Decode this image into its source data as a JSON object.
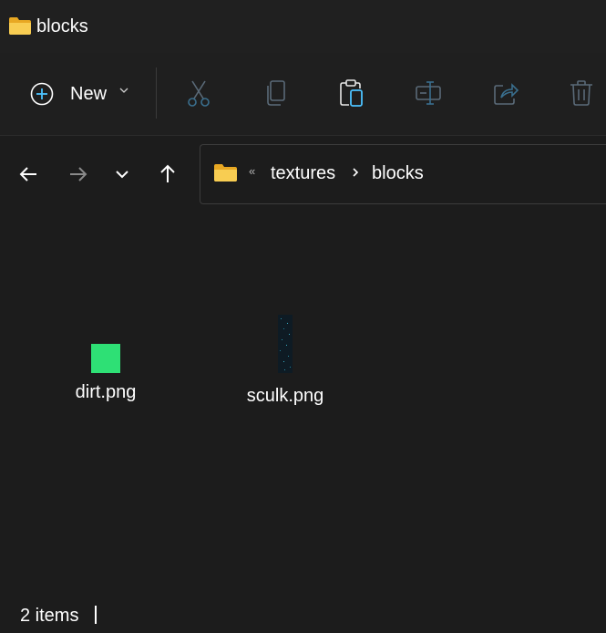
{
  "window": {
    "title": "blocks",
    "icon": "folder-icon"
  },
  "command_bar": {
    "new_label": "New",
    "buttons": [
      {
        "name": "cut",
        "icon": "scissors-icon",
        "enabled": false
      },
      {
        "name": "copy",
        "icon": "copy-icon",
        "enabled": false
      },
      {
        "name": "paste",
        "icon": "clipboard-paste-icon",
        "enabled": true
      },
      {
        "name": "rename",
        "icon": "rename-icon",
        "enabled": false
      },
      {
        "name": "share",
        "icon": "share-icon",
        "enabled": false
      },
      {
        "name": "delete",
        "icon": "trash-icon",
        "enabled": false
      }
    ]
  },
  "navigation": {
    "back_icon": "arrow-left-icon",
    "forward_icon": "arrow-right-icon",
    "recent_icon": "chevron-down-icon",
    "up_icon": "arrow-up-icon"
  },
  "address_bar": {
    "overflow": "«",
    "crumbs": [
      "textures",
      "blocks"
    ]
  },
  "files": [
    {
      "name": "dirt.png",
      "thumb_color": "#2ee075"
    },
    {
      "name": "sculk.png",
      "thumb_color": "#0d1a22"
    }
  ],
  "status": {
    "item_count": "2 items"
  },
  "colors": {
    "background": "#1c1c1c",
    "folder_yellow": "#f4c34a",
    "accent": "#4cc2ff"
  }
}
